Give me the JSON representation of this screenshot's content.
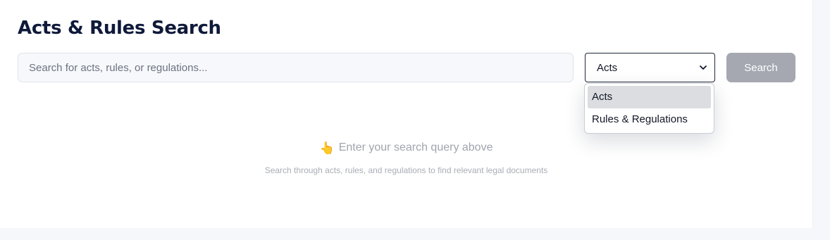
{
  "page": {
    "title": "Acts & Rules Search"
  },
  "search": {
    "placeholder": "Search for acts, rules, or regulations...",
    "value": "",
    "button_label": "Search"
  },
  "filter": {
    "selected": "Acts",
    "options": [
      {
        "label": "Acts"
      },
      {
        "label": "Rules & Regulations"
      }
    ]
  },
  "empty_state": {
    "icon": "pointing-hand-icon",
    "icon_glyph": "👆",
    "heading": "Enter your search query above",
    "subtext": "Search through acts, rules, and regulations to find relevant legal documents"
  },
  "colors": {
    "title": "#0f1a3a",
    "button_disabled": "#a5a8b1",
    "option_highlight": "#dcdde0",
    "muted_text": "#a0a4ad"
  }
}
